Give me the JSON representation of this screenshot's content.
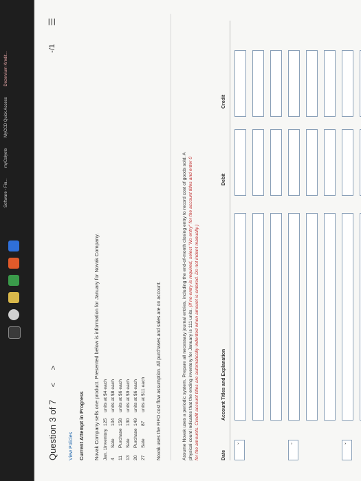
{
  "browser": {
    "tabs": [
      "Software - Fin...",
      "myColyote",
      "MyCCD Quick Access",
      "Dezervium Kredit..."
    ]
  },
  "question": {
    "title": "Question 3 of 7",
    "prev": "<",
    "next": ">",
    "score": "-/1",
    "menu_icon": "hamburger-icon"
  },
  "links": {
    "view_policies": "View Policies"
  },
  "attempt": "Current Attempt in Progress",
  "intro": "Novak Company sells one product. Presented below is information for January for Novak Company.",
  "transactions": [
    {
      "day": "Jan. 1",
      "type": "Inventory",
      "qty": "125",
      "rest": "units at $4 each"
    },
    {
      "day": "4",
      "type": "Sale",
      "qty": "104",
      "rest": "units at $8 each"
    },
    {
      "day": "11",
      "type": "Purchase",
      "qty": "158",
      "rest": "units at $6 each"
    },
    {
      "day": "13",
      "type": "Sale",
      "qty": "130",
      "rest": "units at $9 each"
    },
    {
      "day": "20",
      "type": "Purchase",
      "qty": "149",
      "rest": "units at $6 each"
    },
    {
      "day": "27",
      "type": "Sale",
      "qty": "87",
      "rest": "units at $11 each"
    }
  ],
  "note": "Novak uses the FIFO cost flow assumption. All purchases and sales are on account.",
  "instructions": {
    "main": "Assume Novak uses a periodic system. Prepare all necessary journal entries, including the end-of-month closing entry to record cost of goods sold. A physical count indicates that the ending inventory for January is 111 units.",
    "red": "(If no entry is required, select \"No entry\" for the account titles and enter 0 for the amounts. Credit account titles are automatically indented when amount is entered. Do not indent manually.)"
  },
  "journal": {
    "headers": {
      "date": "Date",
      "account": "Account Titles and Explanation",
      "debit": "Debit",
      "credit": "Credit"
    },
    "dropdown_glyph": "⌄"
  }
}
